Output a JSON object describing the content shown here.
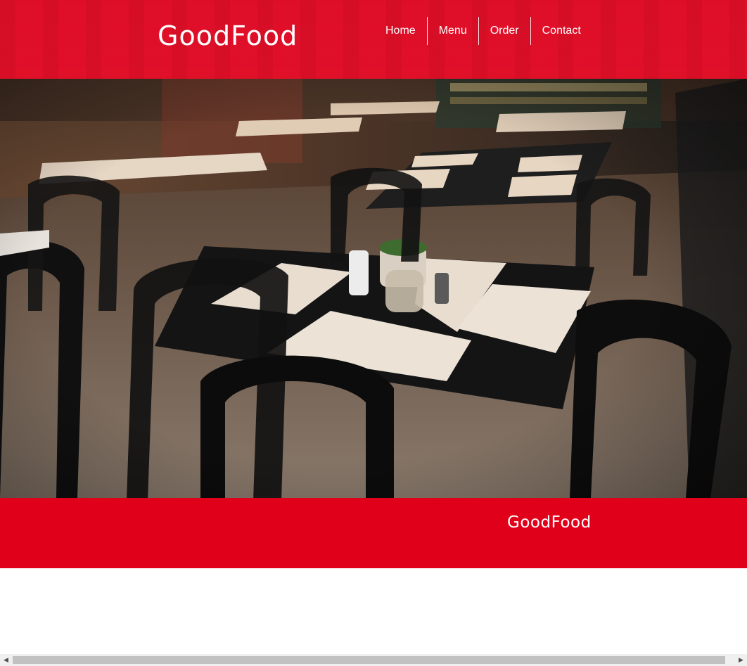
{
  "header": {
    "logo": "GoodFood",
    "nav": [
      {
        "label": "Home"
      },
      {
        "label": "Menu"
      },
      {
        "label": "Order"
      },
      {
        "label": "Contact"
      }
    ]
  },
  "hero": {
    "image": "restaurant-interior-photo"
  },
  "band": {
    "title": "GoodFood"
  },
  "colors": {
    "brand_red": "#e0001a",
    "header_red": "#e4102a",
    "text_on_red": "#ffffff"
  },
  "icons": {
    "scroll_left": "scroll-left-arrow-icon",
    "scroll_right": "scroll-right-arrow-icon"
  }
}
